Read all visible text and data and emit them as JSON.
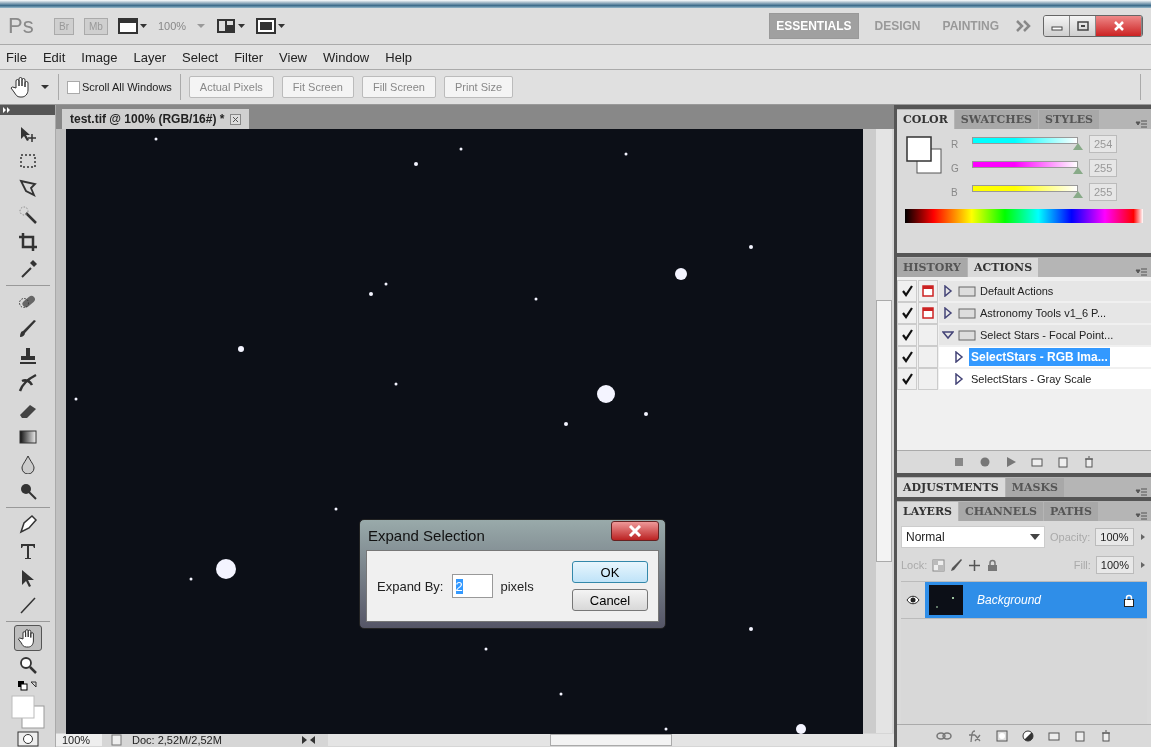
{
  "app_bar": {
    "logo": "Ps",
    "buttons": [
      "Br",
      "Mb"
    ],
    "zoom": "100%",
    "workspaces": [
      {
        "label": "ESSENTIALS",
        "selected": true
      },
      {
        "label": "DESIGN",
        "selected": false
      },
      {
        "label": "PAINTING",
        "selected": false
      }
    ]
  },
  "menu": [
    "File",
    "Edit",
    "Image",
    "Layer",
    "Select",
    "Filter",
    "View",
    "Window",
    "Help"
  ],
  "options_bar": {
    "scroll_all": {
      "label": "Scroll All Windows",
      "checked": false
    },
    "buttons": [
      "Actual Pixels",
      "Fit Screen",
      "Fill Screen",
      "Print Size"
    ]
  },
  "tools": [
    {
      "kind": "move",
      "selected": false
    },
    {
      "kind": "marquee",
      "selected": false
    },
    {
      "kind": "lasso",
      "selected": false
    },
    {
      "kind": "wand",
      "selected": false
    },
    {
      "kind": "crop",
      "selected": false
    },
    {
      "kind": "eyedropper",
      "selected": false
    },
    {
      "kind": "bandage",
      "selected": false
    },
    {
      "kind": "brush",
      "selected": false
    },
    {
      "kind": "stamp",
      "selected": false
    },
    {
      "kind": "history",
      "selected": false
    },
    {
      "kind": "eraser",
      "selected": false
    },
    {
      "kind": "gradient",
      "selected": false
    },
    {
      "kind": "drop",
      "selected": false
    },
    {
      "kind": "dodge",
      "selected": false
    },
    {
      "kind": "pen",
      "selected": false
    },
    {
      "kind": "type",
      "selected": false
    },
    {
      "kind": "arrow",
      "selected": false
    },
    {
      "kind": "line",
      "selected": false
    },
    {
      "kind": "hand",
      "selected": true
    },
    {
      "kind": "zoom",
      "selected": false
    }
  ],
  "document": {
    "tab": "test.tif @ 100% (RGB/16#) *"
  },
  "dialog": {
    "title": "Expand Selection",
    "label": "Expand By:",
    "value": "2",
    "unit": "pixels",
    "buttons": [
      {
        "label": "OK",
        "default": true
      },
      {
        "label": "Cancel",
        "default": false
      }
    ]
  },
  "status_bar": {
    "zoom": "100%",
    "doc": "Doc: 2,52M/2,52M"
  },
  "color_panel": {
    "tabs": [
      {
        "label": "COLOR",
        "selected": true
      },
      {
        "label": "SWATCHES",
        "selected": false
      },
      {
        "label": "STYLES",
        "selected": false
      }
    ],
    "channels": [
      {
        "name": "R",
        "color": "#00ffff",
        "level": 0.996,
        "reading": "254"
      },
      {
        "name": "G",
        "color": "#ff00ff",
        "level": 1,
        "reading": "255"
      },
      {
        "name": "B",
        "color": "#ffff00",
        "level": 1,
        "reading": "255"
      }
    ]
  },
  "actions_panel": {
    "tabs": [
      {
        "label": "HISTORY",
        "selected": false
      },
      {
        "label": "ACTIONS",
        "selected": true
      }
    ],
    "items": [
      {
        "label": "Default Actions",
        "checked": true,
        "dialog": true,
        "expanded": false,
        "selected": false
      },
      {
        "label": "Astronomy Tools v1_6 P...",
        "checked": true,
        "dialog": true,
        "expanded": false,
        "selected": false
      },
      {
        "label": "Select Stars - Focal Point...",
        "checked": true,
        "dialog": false,
        "expanded": true,
        "selected": false,
        "children": [
          {
            "label": "SelectStars - RGB Ima...",
            "checked": true,
            "dialog": false,
            "selected": true
          },
          {
            "label": "SelectStars - Gray Scale",
            "checked": true,
            "dialog": false,
            "selected": false
          }
        ]
      }
    ]
  },
  "adjustments_panel": {
    "tabs": [
      {
        "label": "ADJUSTMENTS",
        "selected": true
      },
      {
        "label": "MASKS",
        "selected": false
      }
    ]
  },
  "layers_panel": {
    "tabs": [
      {
        "label": "LAYERS",
        "selected": true
      },
      {
        "label": "CHANNELS",
        "selected": false
      },
      {
        "label": "PATHS",
        "selected": false
      }
    ],
    "blend_mode": "Normal",
    "opacity_label": "Opacity:",
    "opacity": "100%",
    "lock_label": "Lock:",
    "fill_label": "Fill:",
    "fill": "100%",
    "layers": [
      {
        "name": "Background",
        "visible": true,
        "locked": true,
        "selected": true
      }
    ]
  }
}
